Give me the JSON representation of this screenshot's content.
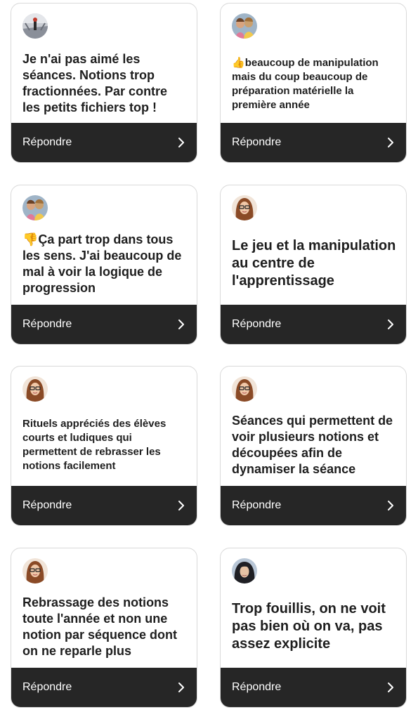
{
  "reply_label": "Répondre",
  "icons": {
    "chevron": "chevron-right-icon",
    "thumbs_up": "👍",
    "thumbs_down": "👎"
  },
  "colors": {
    "reply_bar": "#262626",
    "card_border": "#d9d9d9",
    "text": "#1e1e1e"
  },
  "cards": [
    {
      "avatar": "winter-road-avatar",
      "text": "Je n'ai pas aimé les séances. Notions trop fractionnées. Par contre les petits fichiers top !"
    },
    {
      "avatar": "two-girls-avatar",
      "emoji": "👍",
      "text": "beaucoup de manipulation mais du coup beaucoup de préparation matérielle la première année"
    },
    {
      "avatar": "two-girls-avatar",
      "emoji": "👎",
      "text": "Ça part trop dans tous les sens. J'ai beaucoup de mal à voir la logique de progression"
    },
    {
      "avatar": "woman-glasses-avatar",
      "text": "Le jeu et la manipulation au centre de l'apprentissage"
    },
    {
      "avatar": "woman-glasses-avatar",
      "text": "Rituels appréciés des élèves courts et ludiques qui permettent de rebrasser les notions facilement"
    },
    {
      "avatar": "woman-glasses-avatar",
      "text": "Séances qui permettent de voir plusieurs notions et découpées afin de dynamiser la séance"
    },
    {
      "avatar": "woman-glasses-avatar",
      "text": "Rebrassage des notions toute l'année et non une notion par séquence dont on ne reparle plus"
    },
    {
      "avatar": "dark-hair-avatar",
      "text": "Trop fouillis, on ne voit pas bien où on va, pas assez explicite"
    }
  ]
}
